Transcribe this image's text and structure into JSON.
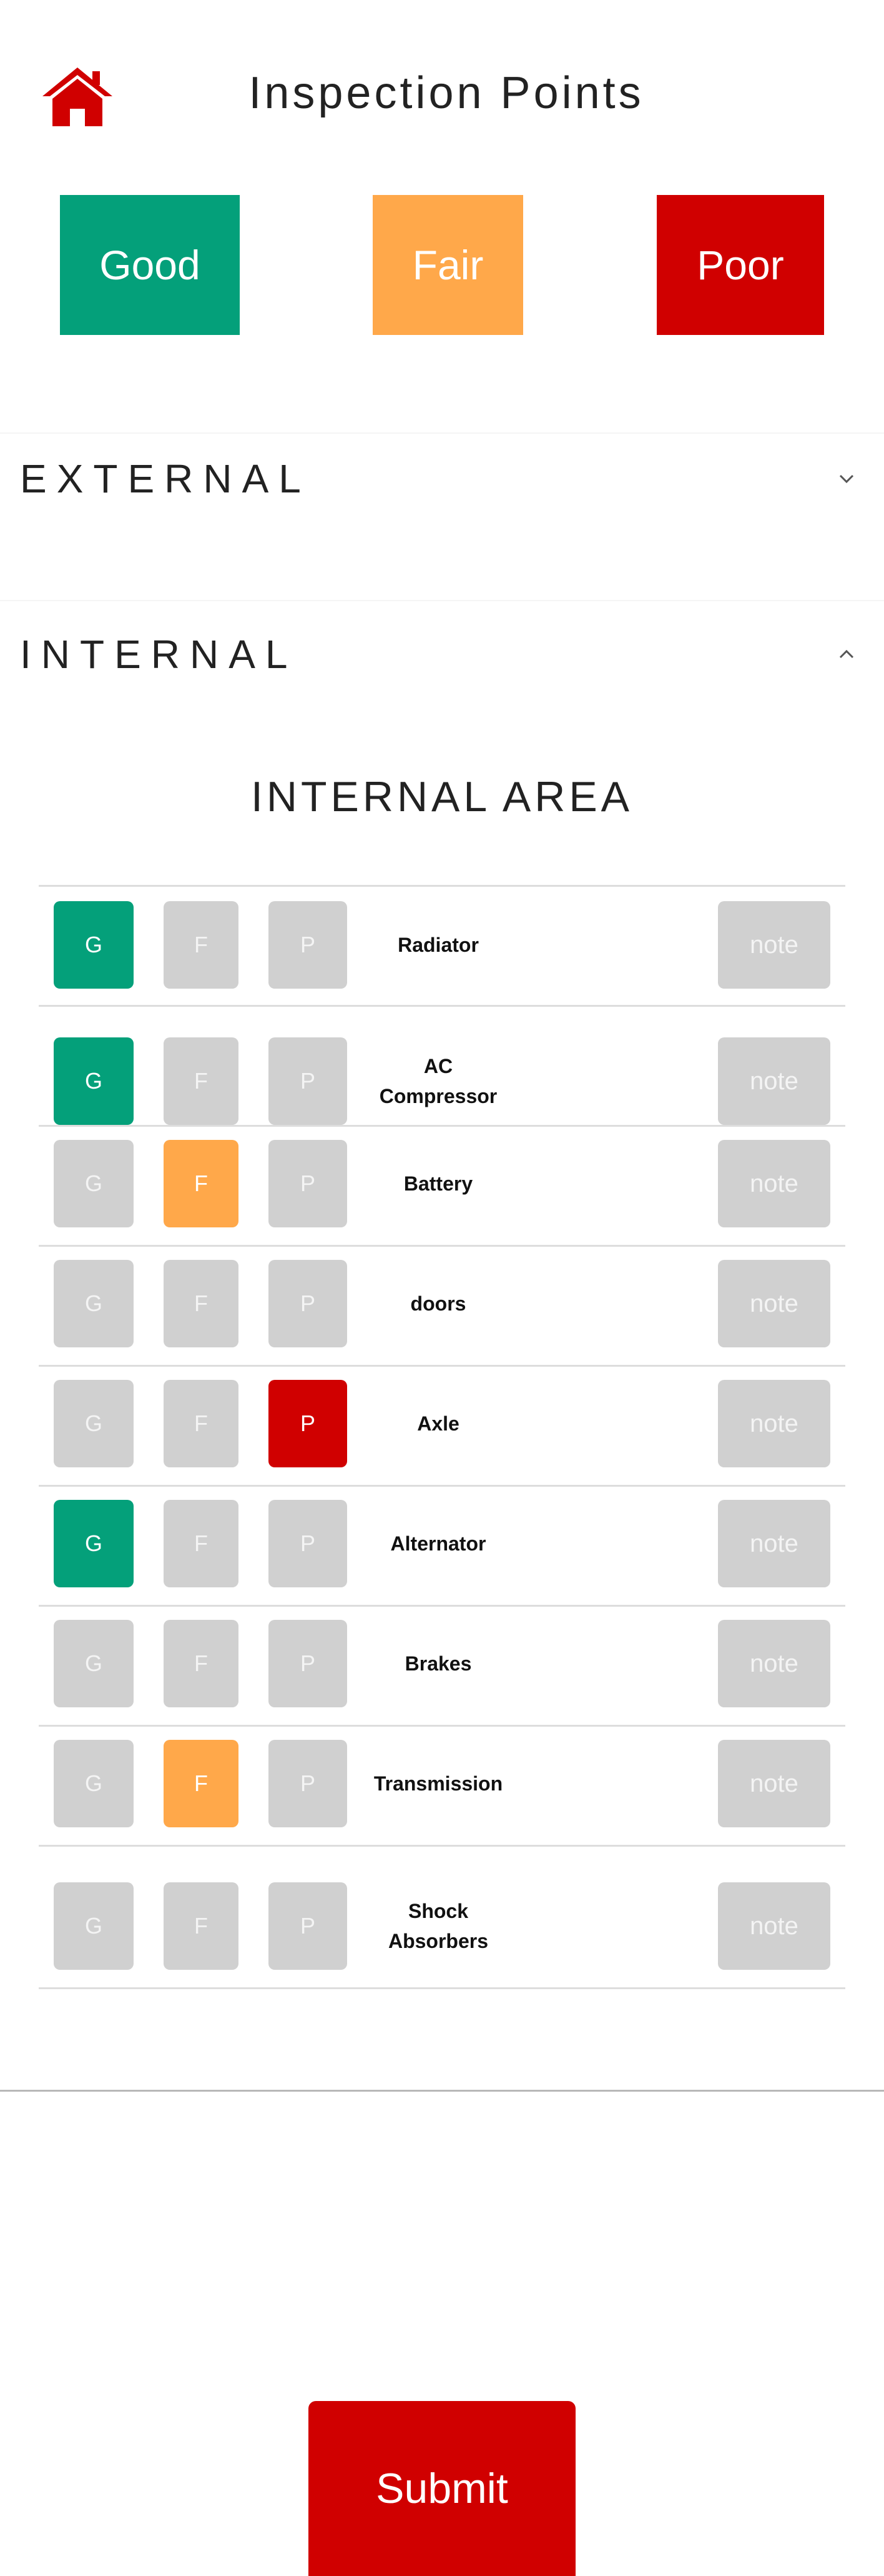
{
  "header": {
    "title": "Inspection Points",
    "home_icon": "home-icon"
  },
  "legend": {
    "good": "Good",
    "fair": "Fair",
    "poor": "Poor"
  },
  "colors": {
    "good": "#04a07a",
    "fair": "#ffa84a",
    "poor": "#d00000",
    "inactive": "#d0d0d0"
  },
  "sections": {
    "external": {
      "label": "EXTERNAL",
      "expanded": false
    },
    "internal": {
      "label": "INTERNAL",
      "expanded": true,
      "area_title": "INTERNAL AREA"
    }
  },
  "rating_labels": {
    "g": "G",
    "f": "F",
    "p": "P",
    "note": "note"
  },
  "rows": [
    {
      "label": "Radiator",
      "rating": "G"
    },
    {
      "label": "AC\nCompressor",
      "rating": "G"
    },
    {
      "label": "Battery",
      "rating": "F"
    },
    {
      "label": "doors",
      "rating": ""
    },
    {
      "label": "Axle",
      "rating": "P"
    },
    {
      "label": "Alternator",
      "rating": "G"
    },
    {
      "label": "Brakes",
      "rating": ""
    },
    {
      "label": "Transmission",
      "rating": "F"
    },
    {
      "label": "Shock\nAbsorbers",
      "rating": ""
    }
  ],
  "submit": {
    "label": "Submit"
  }
}
